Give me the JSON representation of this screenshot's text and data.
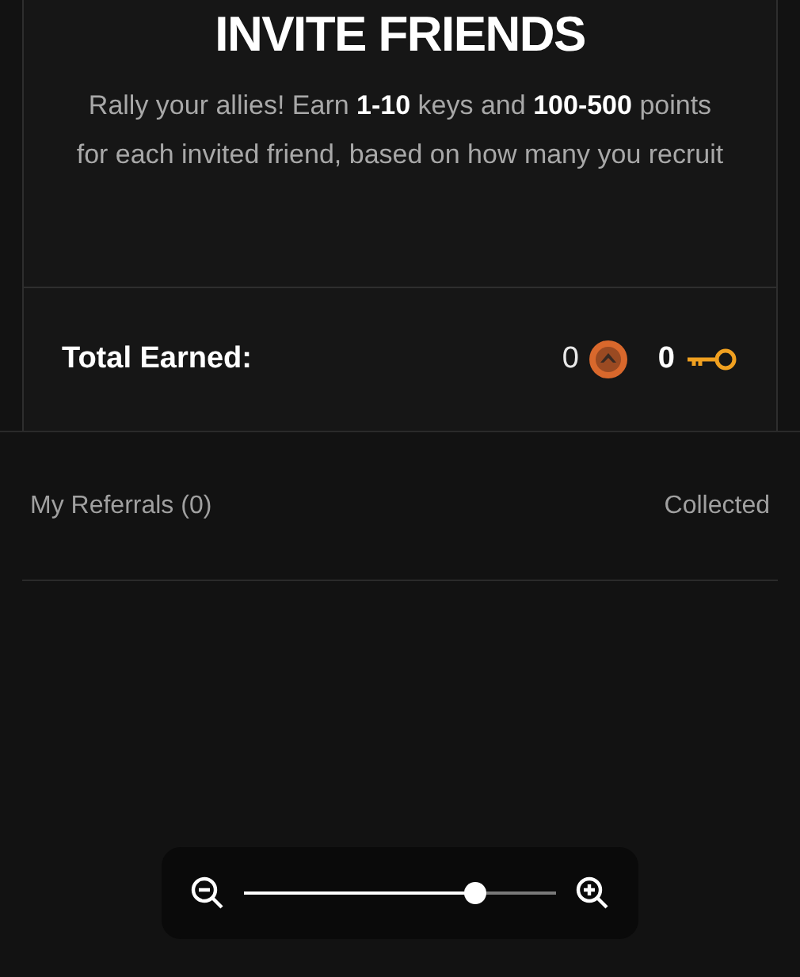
{
  "invite": {
    "title": "INVITE FRIENDS",
    "description": "Rally your allies! Earn **1-10** keys and **100-500** points for each invited friend, based on how many you recruit",
    "total_label": "Total Earned:",
    "points": "0",
    "keys": "0"
  },
  "referrals": {
    "title": "My Referrals (0)",
    "status": "Collected"
  },
  "zoom": {
    "level": 0.74
  }
}
